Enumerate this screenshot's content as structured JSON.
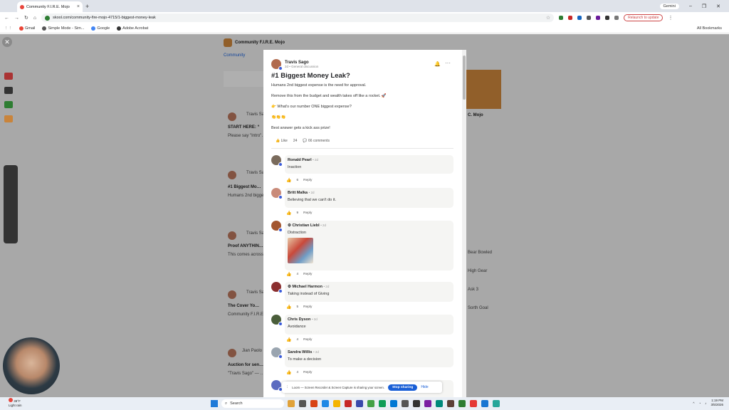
{
  "browser": {
    "tab_title": "Community F.I.R.E. Mojo",
    "url": "skool.com/community-fire-mojo-4715/1-biggest-money-leak",
    "gemini_label": "Gemini",
    "relaunch_label": "Relaunch to update",
    "bookmarks": [
      "Gmail",
      "Simple Mode - Sim...",
      "Google",
      "Adobe Acrobat"
    ],
    "all_bookmarks": "All Bookmarks"
  },
  "background": {
    "group_name": "Community F.I.R.E. Mojo",
    "nav_community": "Community",
    "posts": [
      {
        "author": "Travis Sago",
        "title": "START HERE: “",
        "snippet": "Please say \"Intro\"…"
      },
      {
        "author": "Travis Sago",
        "title": "#1 Biggest Mo…",
        "snippet": "Humans 2nd biggest…"
      },
      {
        "author": "Travis Sago",
        "title": "Proof ANYTHIN…",
        "snippet": "This comes across…"
      },
      {
        "author": "Travis Sago",
        "title": "The Cover Yo…",
        "snippet": "Community F.I.R.E.…"
      },
      {
        "author": "Jian Paolo",
        "title": "Auction for sen…",
        "snippet": "\"Travis Sago\" — …"
      }
    ],
    "right_panel": {
      "title": "C. Mojo",
      "items": [
        "Bear Bowled",
        "High Gear",
        "Ask 3",
        "Sorth Goal"
      ]
    }
  },
  "post": {
    "author": "Travis Sago",
    "meta": "2d • General discussion",
    "title": "#1 Biggest Money Leak?",
    "paragraphs": [
      "Humans 2nd biggest expense is the need for approval.",
      "Remove this from the budget and wealth takes off like a rocket. 🚀",
      "👉 What's our number ONE biggest expense?",
      "👏👏👏",
      "Best answer gets a kick ass prize!"
    ],
    "like_label": "Like",
    "like_count": "24",
    "comments_label": "66 comments"
  },
  "comments": [
    {
      "name": "Ronald Pearl",
      "time": "• 2d",
      "text": "Inaction",
      "likes": "6",
      "reply": "Reply",
      "avatar_color": "#7a6b5c",
      "verified": false
    },
    {
      "name": "Britt Malka",
      "time": "• 2d",
      "text": "Believing that we can't do it.",
      "likes": "9",
      "reply": "Reply",
      "avatar_color": "#c98b7a",
      "verified": false
    },
    {
      "name": "Christian Liebl",
      "time": "• 2d",
      "text": "Distraction",
      "likes": "4",
      "reply": "Reply",
      "avatar_color": "#a3562f",
      "verified": true,
      "has_image": true
    },
    {
      "name": "Michael Harmon",
      "time": "• 2d",
      "text": "Taking instead of Giving",
      "likes": "5",
      "reply": "Reply",
      "avatar_color": "#8b2f2f",
      "verified": true
    },
    {
      "name": "Chris Dyson",
      "time": "• 2d",
      "text": "Avoidance",
      "likes": "4",
      "reply": "Reply",
      "avatar_color": "#4a5e3a",
      "verified": false
    },
    {
      "name": "Sandra Willis",
      "time": "• 2d",
      "text": "To make a decision",
      "likes": "4",
      "reply": "Reply",
      "avatar_color": "#9aa5b0",
      "verified": false
    }
  ],
  "sharing": {
    "message": "Loom — Screen Recorder & Screen Capture is sharing your screen.",
    "stop_label": "Stop sharing",
    "hide_label": "Hide"
  },
  "taskbar": {
    "weather_temp": "39°F",
    "weather_desc": "Light rain",
    "search_label": "Search",
    "time": "1:19 PM",
    "date": "3/5/2026"
  }
}
